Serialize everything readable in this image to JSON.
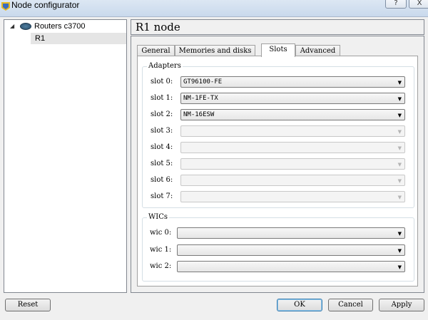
{
  "window": {
    "title": "Node configurator",
    "help_label": "?",
    "close_label": "X"
  },
  "tree": {
    "group_label": "Routers c3700",
    "expand_arrow": "◢",
    "child_label": "R1"
  },
  "node_title": "R1 node",
  "tabs": [
    {
      "label": "General"
    },
    {
      "label": "Memories and disks"
    },
    {
      "label": "Slots"
    },
    {
      "label": "Advanced"
    }
  ],
  "adapters": {
    "title": "Adapters",
    "slots": [
      {
        "label": "slot 0:",
        "value": "GT96100-FE",
        "enabled": true
      },
      {
        "label": "slot 1:",
        "value": "NM-1FE-TX",
        "enabled": true
      },
      {
        "label": "slot 2:",
        "value": "NM-16ESW",
        "enabled": true
      },
      {
        "label": "slot 3:",
        "value": "",
        "enabled": false
      },
      {
        "label": "slot 4:",
        "value": "",
        "enabled": false
      },
      {
        "label": "slot 5:",
        "value": "",
        "enabled": false
      },
      {
        "label": "slot 6:",
        "value": "",
        "enabled": false
      },
      {
        "label": "slot 7:",
        "value": "",
        "enabled": false
      }
    ]
  },
  "wics": {
    "title": "WICs",
    "slots": [
      {
        "label": "wic 0:",
        "value": ""
      },
      {
        "label": "wic 1:",
        "value": ""
      },
      {
        "label": "wic 2:",
        "value": ""
      }
    ]
  },
  "buttons": {
    "reset": "Reset",
    "ok": "OK",
    "cancel": "Cancel",
    "apply": "Apply"
  },
  "icons": {
    "dropdown": "▼"
  }
}
